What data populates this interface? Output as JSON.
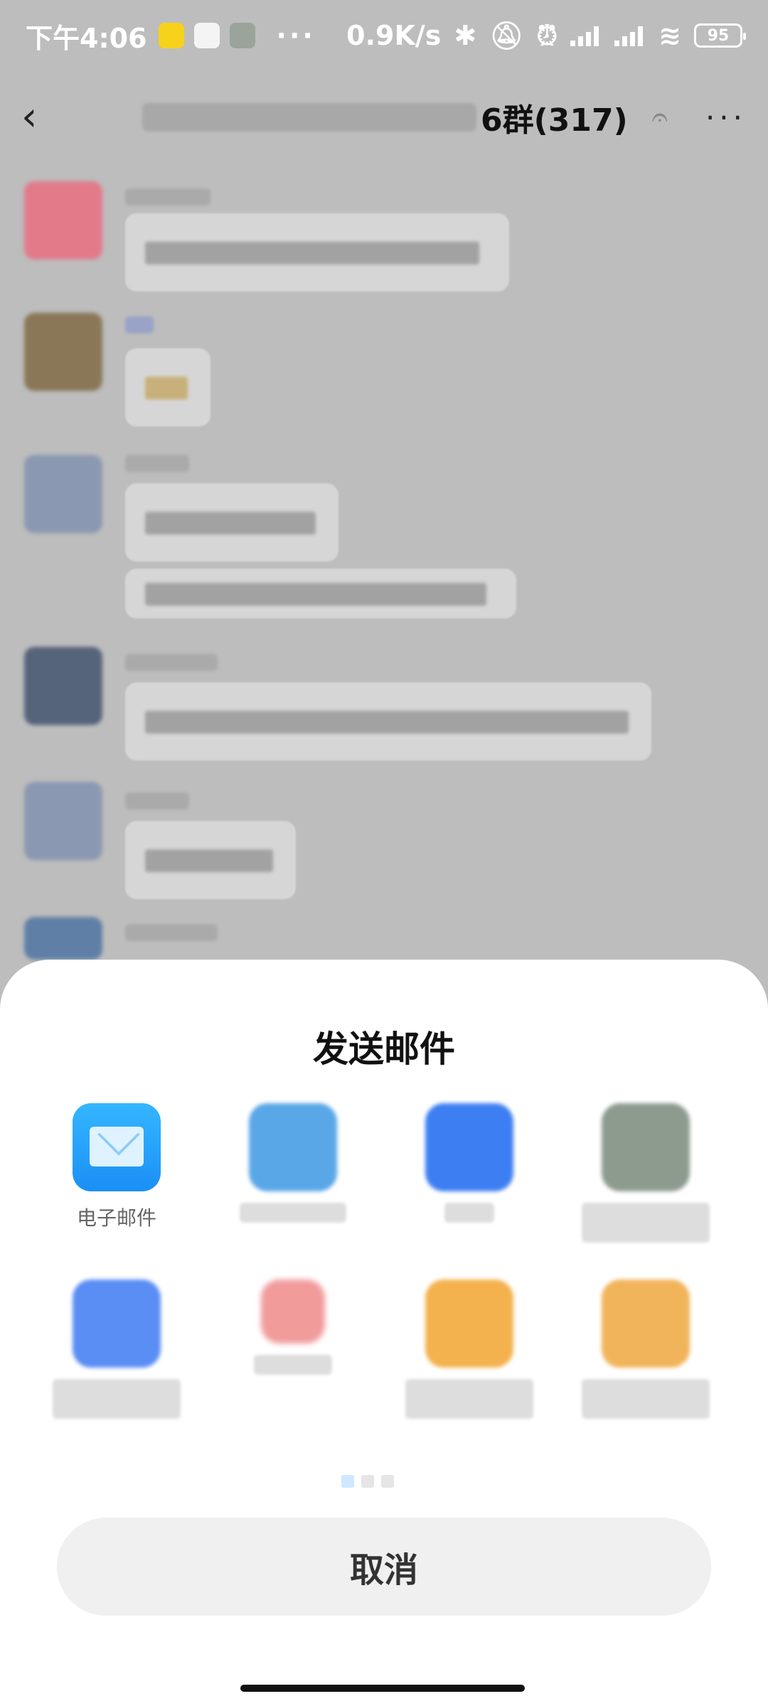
{
  "status_bar": {
    "time": "下午4:06",
    "more": "···",
    "speed": "0.9K/s",
    "battery": "95"
  },
  "header": {
    "title_suffix": "6群(317)",
    "back_icon": "chevron-left-icon",
    "ear_icon": "ear-icon",
    "more_icon": "more-dots-icon"
  },
  "sheet": {
    "title": "发送邮件",
    "apps": [
      {
        "label": "电子邮件",
        "icon": "mail-icon"
      }
    ],
    "cancel_label": "取消"
  },
  "colors": {
    "mail_icon": "#1a8ff6",
    "sheet_bg": "#ffffff",
    "cancel_bg": "#f0f0f0",
    "overlay": "#bdbdbd"
  }
}
